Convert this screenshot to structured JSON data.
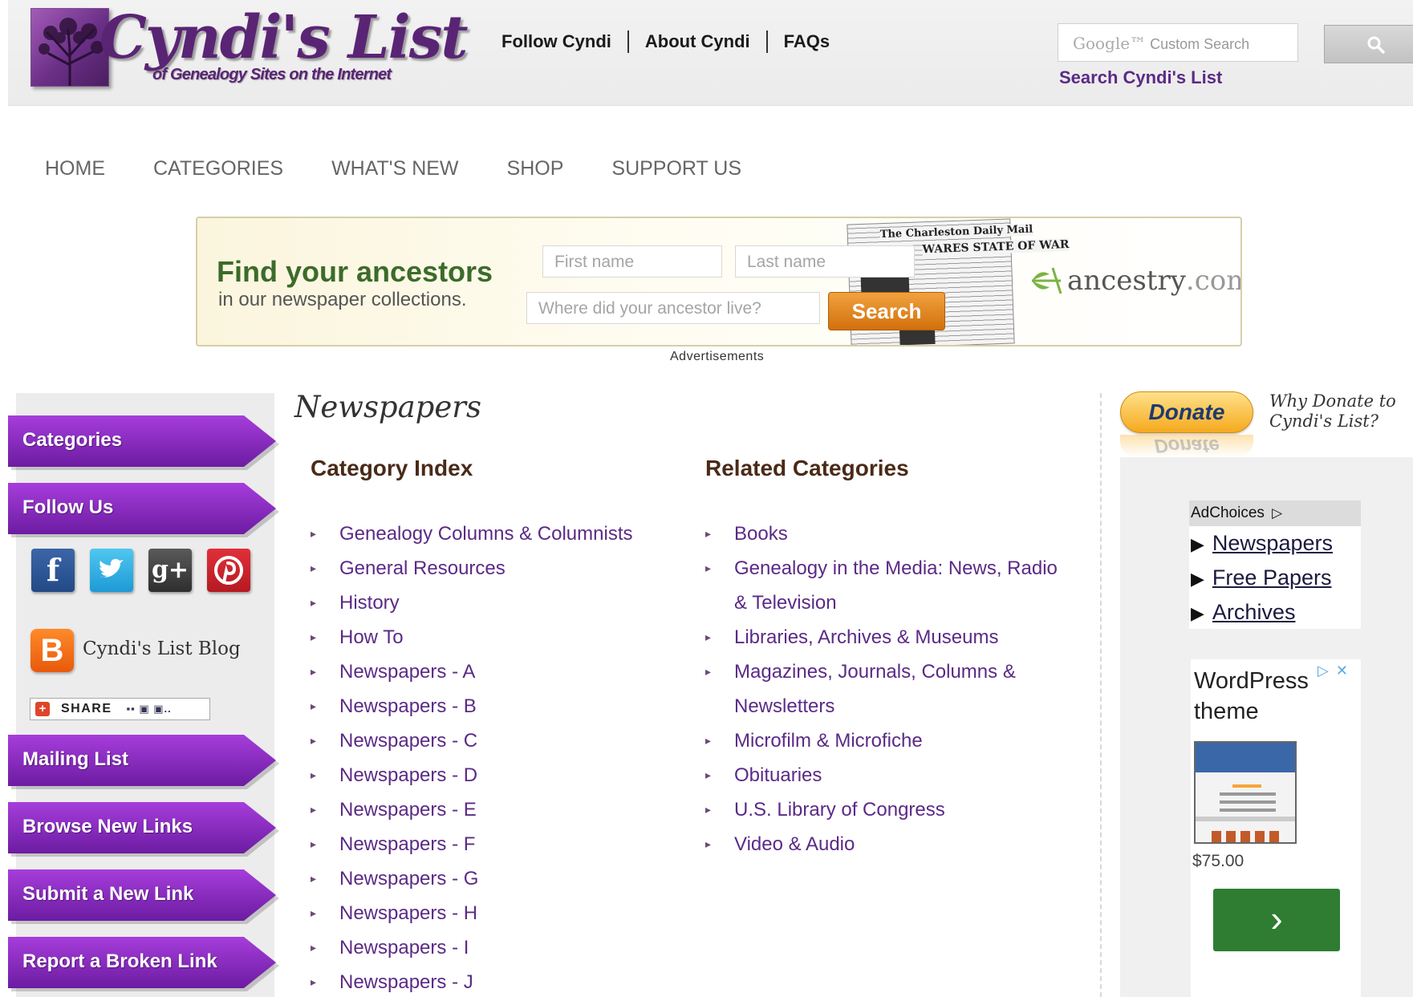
{
  "header": {
    "logo_title": "Cyndi's List",
    "logo_subtitle": "of Genealogy Sites on the Internet",
    "links": [
      "Follow Cyndi",
      "About Cyndi",
      "FAQs"
    ],
    "search_placeholder_brand": "Google™",
    "search_placeholder_text": "Custom Search",
    "search_caption": "Search Cyndi's List",
    "icons": {
      "search": "magnifier-icon"
    }
  },
  "nav": {
    "items": [
      "HOME",
      "CATEGORIES",
      "WHAT'S NEW",
      "SHOP",
      "SUPPORT US"
    ]
  },
  "ad_banner": {
    "headline": "Find your ancestors",
    "subline": "in our newspaper collections.",
    "first_name_placeholder": "First name",
    "last_name_placeholder": "Last name",
    "where_placeholder": "Where did your ancestor live?",
    "search_label": "Search",
    "brand": "ancestry",
    "brand_suffix": ".com",
    "newspaper_masthead": "The Charleston Daily Mail",
    "newspaper_headline": "WARES STATE OF WAR",
    "caption": "Advertisements"
  },
  "sidebar": {
    "categories_label": "Categories",
    "follow_label": "Follow Us",
    "social": [
      {
        "name": "facebook",
        "glyph": "f"
      },
      {
        "name": "twitter",
        "glyph": "t"
      },
      {
        "name": "google-plus",
        "glyph": "g+"
      },
      {
        "name": "pinterest",
        "glyph": "p"
      }
    ],
    "blog_label": "Cyndi's List Blog",
    "share_label": "SHARE",
    "mailing_label": "Mailing List",
    "browse_label": "Browse New Links",
    "submit_label": "Submit a New Link",
    "report_label": "Report a Broken Link"
  },
  "main": {
    "page_title": "Newspapers",
    "index_heading": "Category Index",
    "related_heading": "Related Categories",
    "index_items": [
      "Genealogy Columns & Columnists",
      "General Resources",
      "History",
      "How To",
      "Newspapers - A",
      "Newspapers - B",
      "Newspapers - C",
      "Newspapers - D",
      "Newspapers - E",
      "Newspapers - F",
      "Newspapers - G",
      "Newspapers - H",
      "Newspapers - I",
      "Newspapers - J"
    ],
    "related_items": [
      "Books",
      "Genealogy in the Media: News, Radio",
      "& Television",
      "Libraries, Archives & Museums",
      "Magazines, Journals, Columns &",
      "Newsletters",
      "Microfilm & Microfiche",
      "Obituaries",
      "U.S. Library of Congress",
      "Video & Audio"
    ]
  },
  "right_column": {
    "donate_label": "Donate",
    "why_donate": "Why Donate to Cyndi's List?",
    "adchoices_label": "AdChoices",
    "ad_links": [
      "Newspapers",
      "Free Papers",
      "Archives"
    ],
    "wp_ad_title": "WordPress theme",
    "wp_ad_price": "$75.00",
    "wp_ad_button": "›"
  },
  "colors": {
    "brand_purple": "#5b2a86",
    "sidebar_button": "#8a2cc0",
    "ad_headline_green": "#3c6b2a",
    "donate_orange": "#f5a91d"
  }
}
